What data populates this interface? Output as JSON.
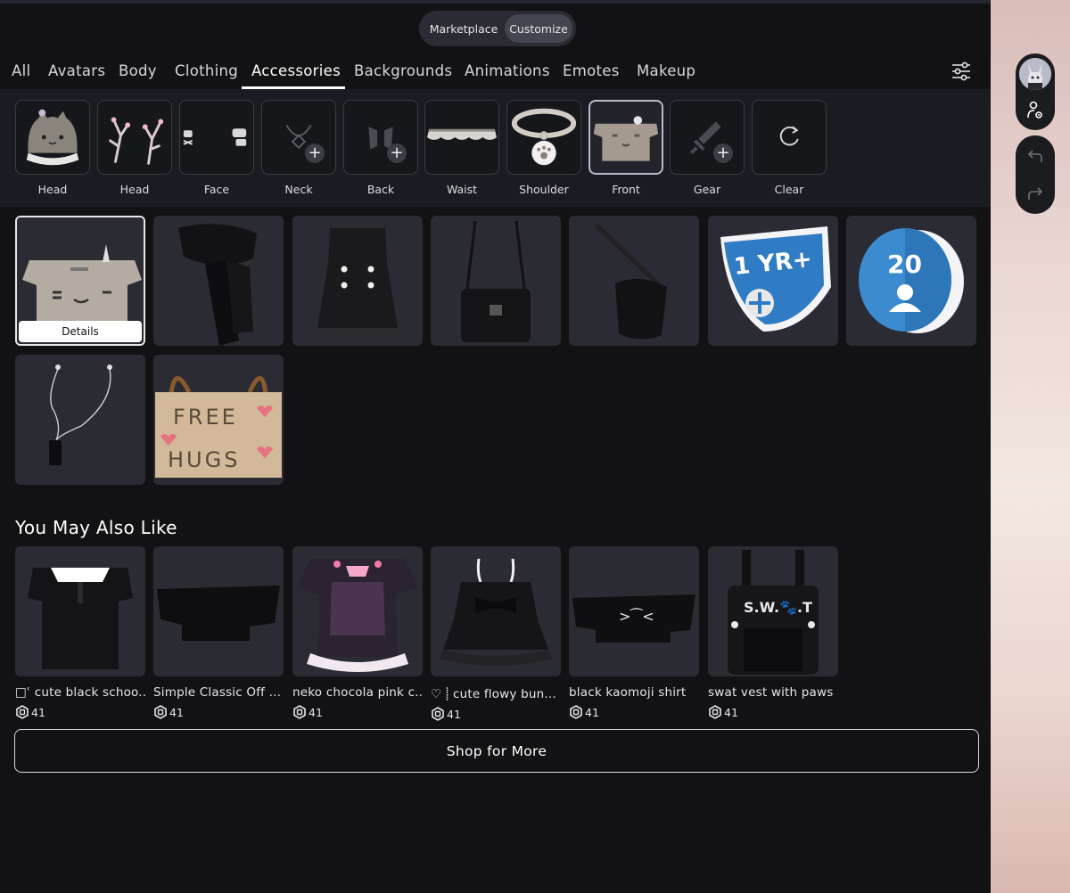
{
  "mode_toggle": {
    "marketplace": "Marketplace",
    "customize": "Customize",
    "active": "customize"
  },
  "tabs": [
    {
      "label": "All"
    },
    {
      "label": "Avatars"
    },
    {
      "label": "Body"
    },
    {
      "label": "Clothing"
    },
    {
      "label": "Accessories",
      "active": true
    },
    {
      "label": "Backgrounds"
    },
    {
      "label": "Animations"
    },
    {
      "label": "Emotes"
    },
    {
      "label": "Makeup"
    }
  ],
  "filter_icon": "sliders-icon",
  "slots": [
    {
      "label": "Head",
      "icon": "cat-hat-thumbnail"
    },
    {
      "label": "Head",
      "icon": "branch-antlers-thumbnail"
    },
    {
      "label": "Face",
      "icon": "face-accessories-thumbnail"
    },
    {
      "label": "Neck",
      "icon": "necklace-plus-icon"
    },
    {
      "label": "Back",
      "icon": "wings-plus-icon"
    },
    {
      "label": "Waist",
      "icon": "ruffle-skirt-thumbnail"
    },
    {
      "label": "Shoulder",
      "icon": "paw-collar-thumbnail"
    },
    {
      "label": "Front",
      "icon": "cat-top-thumbnail",
      "selected": true
    },
    {
      "label": "Gear",
      "icon": "sword-plus-icon"
    },
    {
      "label": "Clear",
      "icon": "refresh-icon"
    }
  ],
  "inventory": {
    "details_label": "Details",
    "items": [
      {
        "icon": "cat-crop-top",
        "selected": true
      },
      {
        "icon": "black-scarf"
      },
      {
        "icon": "black-dress-buttons"
      },
      {
        "icon": "black-satchel-bag"
      },
      {
        "icon": "black-shoulder-bag"
      },
      {
        "icon": "one-year-badge",
        "badge_text": "1 YR+"
      },
      {
        "icon": "twenty-coin-badge",
        "badge_text": "20"
      },
      {
        "icon": "earphones-mp3"
      },
      {
        "icon": "free-hugs-sign",
        "sign_text": [
          "FREE",
          "HUGS"
        ]
      }
    ]
  },
  "recommendations": {
    "title": "You May Also Like",
    "items": [
      {
        "name": "□ʿ cute black schoo...",
        "price": "41",
        "icon": "black-school-top"
      },
      {
        "name": "Simple Classic Off ...",
        "price": "41",
        "icon": "off-shoulder-top"
      },
      {
        "name": "neko chocola pink c...",
        "price": "41",
        "icon": "neko-maid-dress"
      },
      {
        "name": "♡ ⸽ cute flowy bun...",
        "price": "41",
        "icon": "flowy-bunny-top"
      },
      {
        "name": "black kaomoji shirt",
        "price": "41",
        "icon": "kaomoji-shirt",
        "shirt_text": ">⁀<"
      },
      {
        "name": "swat vest with paws",
        "price": "41",
        "icon": "swat-vest",
        "vest_text": "S.W.🐾.T"
      }
    ],
    "currency_icon": "robux-icon"
  },
  "shop_button": "Shop for More",
  "side_controls": {
    "avatar_icon": "avatar-thumbnail",
    "settings_icon": "avatar-settings-icon",
    "undo_icon": "undo-icon",
    "redo_icon": "redo-icon"
  },
  "colors": {
    "background": "#121215",
    "slot_bar": "#1b1c21",
    "tile": "#2a2b33",
    "accent_white": "#ffffff"
  }
}
